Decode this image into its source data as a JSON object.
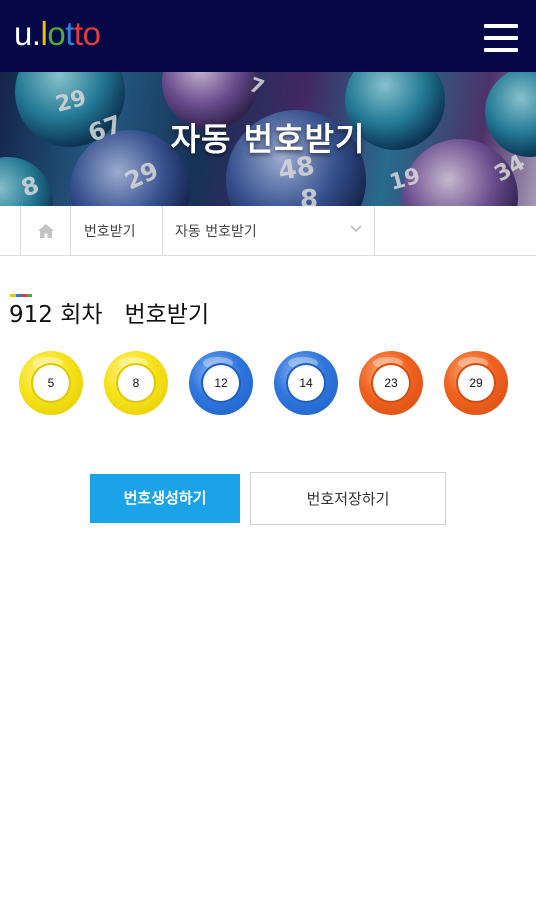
{
  "header": {
    "logo": [
      "u",
      ".",
      "l",
      "o",
      "t",
      "t",
      "o"
    ],
    "logo_colors": [
      "#ffffff",
      "#ffffff",
      "#f2c200",
      "#4cae3a",
      "#2f7fd6",
      "#e23b3b",
      "#e23b3b"
    ],
    "menu_icon": "hamburger-menu-icon"
  },
  "hero": {
    "title": "자동 번호받기",
    "ball_numbers": [
      "29",
      "67",
      "29",
      "48",
      "8",
      "7",
      "19",
      "34",
      "8"
    ]
  },
  "breadcrumb": {
    "home_icon": "home-icon",
    "level1": "번호받기",
    "level2": "자동 번호받기",
    "dropdown_icon": "chevron-down-icon"
  },
  "section": {
    "accent_colors": [
      "#f2c200",
      "#2f7fd6",
      "#e23b3b",
      "#4cae3a"
    ],
    "round_title": "912 회차   번호받기"
  },
  "balls": [
    {
      "number": "5",
      "color": "#f7e21a",
      "ring": "#e0c800"
    },
    {
      "number": "8",
      "color": "#f7e21a",
      "ring": "#e0c800"
    },
    {
      "number": "12",
      "color": "#2f76de",
      "ring": "#1f5fc2"
    },
    {
      "number": "14",
      "color": "#2f76de",
      "ring": "#1f5fc2"
    },
    {
      "number": "23",
      "color": "#f0611f",
      "ring": "#d24d12"
    },
    {
      "number": "29",
      "color": "#f0611f",
      "ring": "#d24d12"
    }
  ],
  "actions": {
    "generate_label": "번호생성하기",
    "save_label": "번호저장하기",
    "generate_color": "#1aa3e8"
  }
}
